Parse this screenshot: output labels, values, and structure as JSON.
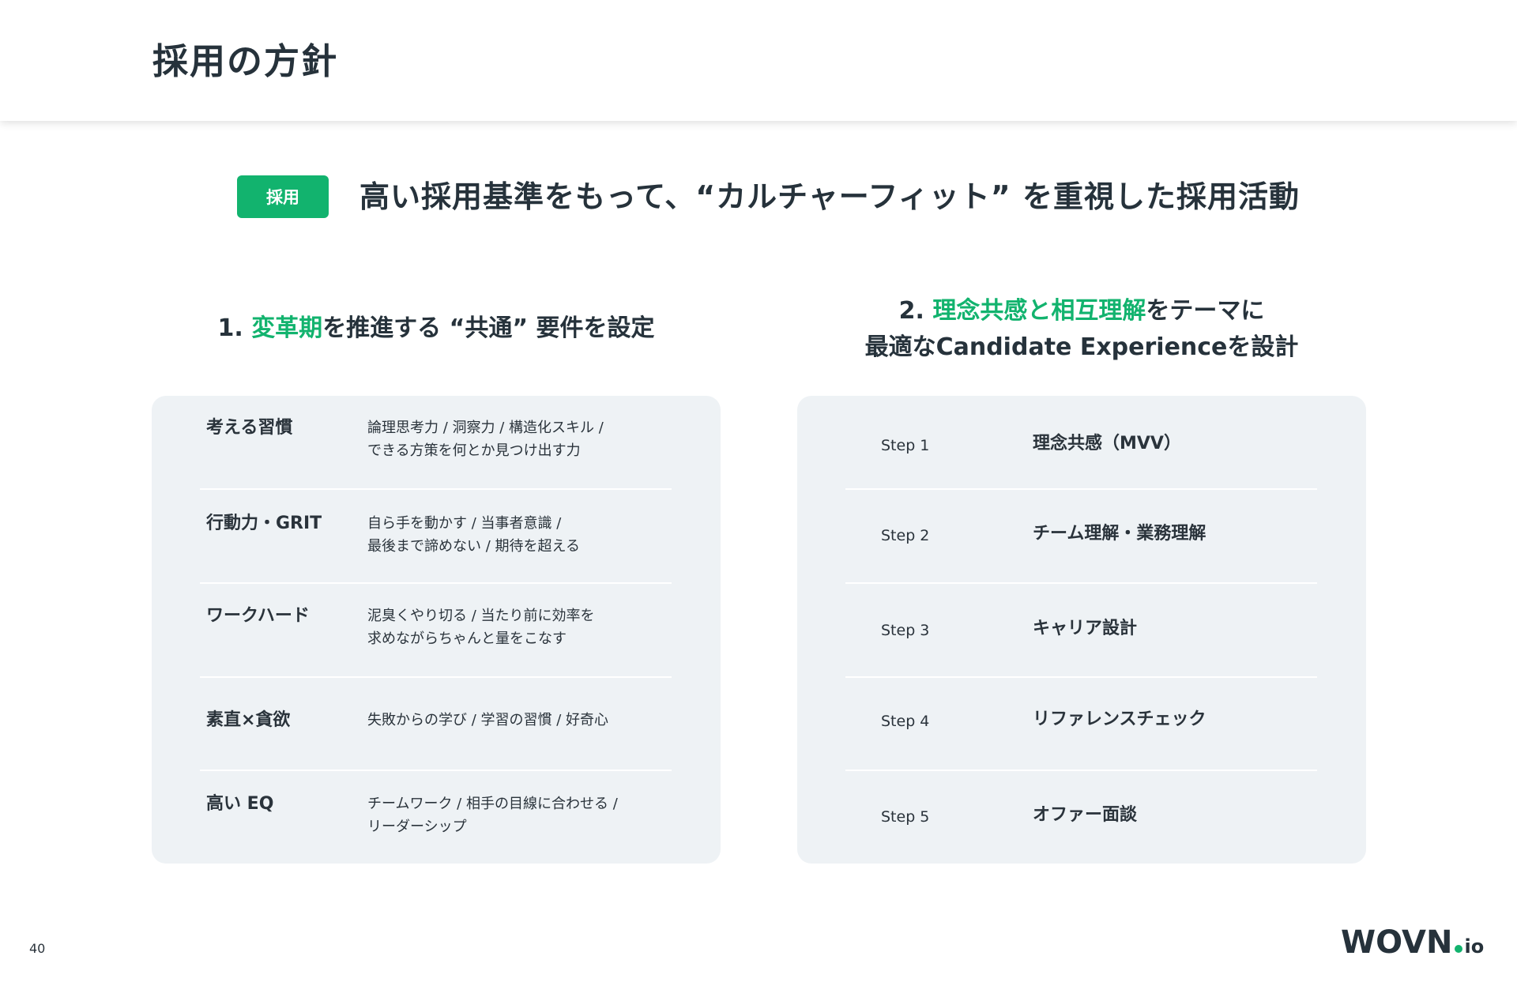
{
  "header": {
    "title": "採用の方針"
  },
  "badge": {
    "label": "採用"
  },
  "headline": "高い採用基準をもって、“カルチャーフィット” を重視した採用活動",
  "section1": {
    "title_prefix": "1. ",
    "title_highlight": "変革期",
    "title_suffix": "を推進する “共通” 要件を設定",
    "rows": [
      {
        "label": "考える習慣",
        "desc_line1": "論理思考力 / 洞察力 / 構造化スキル /",
        "desc_line2": "できる方策を何とか見つけ出す力"
      },
      {
        "label": "行動力・GRIT",
        "desc_line1": "自ら手を動かす / 当事者意識 /",
        "desc_line2": "最後まで諦めない / 期待を超える"
      },
      {
        "label": "ワークハード",
        "desc_line1": "泥臭くやり切る / 当たり前に効率を",
        "desc_line2": "求めながらちゃんと量をこなす"
      },
      {
        "label": "素直×貪欲",
        "desc_line1": "失敗からの学び / 学習の習慣 / 好奇心",
        "desc_line2": ""
      },
      {
        "label": "高い EQ",
        "desc_line1": "チームワーク / 相手の目線に合わせる /",
        "desc_line2": "リーダーシップ"
      }
    ]
  },
  "section2": {
    "title_prefix": "2. ",
    "title_highlight": "理念共感と相互理解",
    "title_suffix": "をテーマに",
    "title_line2": "最適なCandidate Experienceを設計",
    "steps": [
      {
        "label": "Step 1",
        "text": "理念共感（MVV）"
      },
      {
        "label": "Step 2",
        "text": "チーム理解・業務理解"
      },
      {
        "label": "Step 3",
        "text": "キャリア設計"
      },
      {
        "label": "Step 4",
        "text": "リファレンスチェック"
      },
      {
        "label": "Step 5",
        "text": "オファー面談"
      }
    ]
  },
  "footer": {
    "page_number": "40",
    "logo_main": "WOVN",
    "logo_suffix": "io"
  },
  "colors": {
    "accent": "#12b36e",
    "text": "#26323b",
    "card_bg": "#eef2f5"
  }
}
